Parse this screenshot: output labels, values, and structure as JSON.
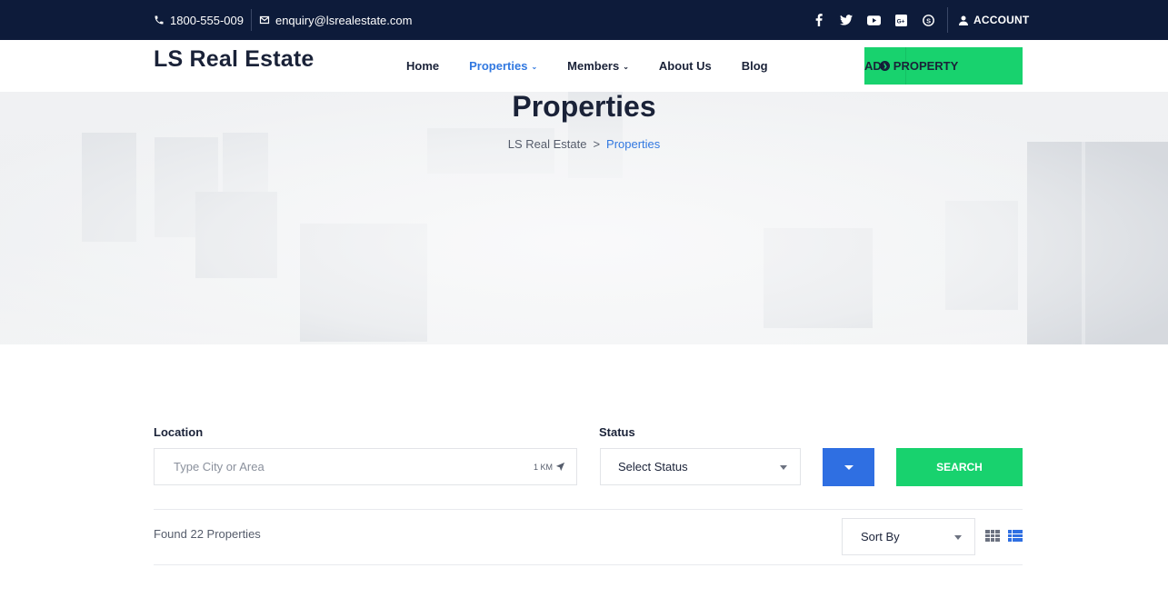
{
  "topbar": {
    "phone": "1800-555-009",
    "email": "enquiry@lsrealestate.com",
    "socials": [
      "facebook-icon",
      "twitter-icon",
      "youtube-icon",
      "google-plus-icon",
      "skype-icon"
    ],
    "account_label": "ACCOUNT"
  },
  "header": {
    "logo": "LS Real Estate",
    "nav": [
      {
        "label": "Home",
        "active": false,
        "dropdown": false
      },
      {
        "label": "Properties",
        "active": true,
        "dropdown": true
      },
      {
        "label": "Members",
        "active": false,
        "dropdown": true
      },
      {
        "label": "About Us",
        "active": false,
        "dropdown": false
      },
      {
        "label": "Blog",
        "active": false,
        "dropdown": false
      }
    ],
    "add_property_label": "ADD PROPERTY"
  },
  "hero": {
    "title": "Properties",
    "breadcrumb": {
      "home": "LS Real Estate",
      "separator": ">",
      "current": "Properties"
    }
  },
  "search": {
    "location_label": "Location",
    "location_placeholder": "Type City or Area",
    "radius": "1 KM",
    "status_label": "Status",
    "status_value": "Select Status",
    "search_label": "SEARCH"
  },
  "results": {
    "found_text": "Found 22 Properties",
    "sort_value": "Sort By",
    "view_mode": "list"
  },
  "colors": {
    "topbar_bg": "#0d1b3a",
    "accent_green": "#18d26e",
    "accent_blue": "#2f6fe2",
    "link_blue": "#3178e0",
    "text_dark": "#1a2238"
  }
}
